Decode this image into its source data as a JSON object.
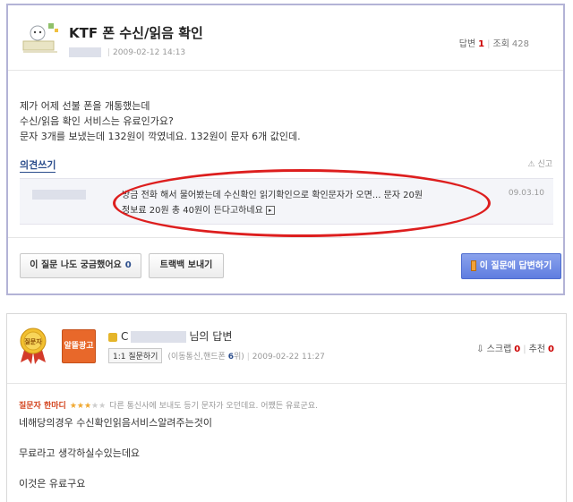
{
  "question": {
    "title": "KTF 폰 수신/읽음 확인",
    "date": "2009-02-12 14:13",
    "answers_label": "답변",
    "answers_count": "1",
    "views_label": "조회",
    "views_count": "428",
    "body_lines": [
      "제가 어제 선불 폰을 개통했는데",
      "수신/읽음 확인 서비스는 유료인가요?",
      "문자 3개를 보냈는데 132원이 깍였네요. 132원이 문자 6개 값인데."
    ],
    "opinion_label": "의견쓰기",
    "report_label": "신고",
    "comment": {
      "line1": "방금 전화 해서 물어봤는데 수신확인 읽기확인으로 확인문자가 오면... 문자 20원",
      "line2": "정보료 20원 총 40원이 든다고하네요",
      "date": "09.03.10"
    },
    "buttons": {
      "curious_label": "이 질문 나도 궁금했어요",
      "curious_count": "0",
      "trackback_label": "트랙백 보내기",
      "answer_label": "이 질문에 답변하기"
    },
    "colors": {
      "accent_red": "#dd1e1e",
      "link_blue": "#2b4d8c",
      "answer_btn": "#6f8be4"
    }
  },
  "answer": {
    "medal_text": "질문자",
    "badge_text": "알뜰광고",
    "title_prefix": "C",
    "title_suffix": "님의 답변",
    "chip_label": "1:1 질문하기",
    "meta_category": "(이동통신,핸드폰",
    "meta_rank": "6",
    "meta_rank_suffix": "위)",
    "date": "2009-02-22 11:27",
    "scrap_label": "스크랩",
    "scrap_count": "0",
    "recommend_label": "추천",
    "recommend_count": "0",
    "asker_comment_label": "질문자 한마디",
    "rating": 3,
    "asker_comment": "다른 통신사에 보내도 등기 문자가 오던데요. 어쨌든 유료군요.",
    "body_lines": [
      "네해당의경우 수신확인읽음서비스알려주는것이",
      "",
      "무료라고 생각하실수있는데요",
      "",
      "이것은 유료구요"
    ]
  }
}
